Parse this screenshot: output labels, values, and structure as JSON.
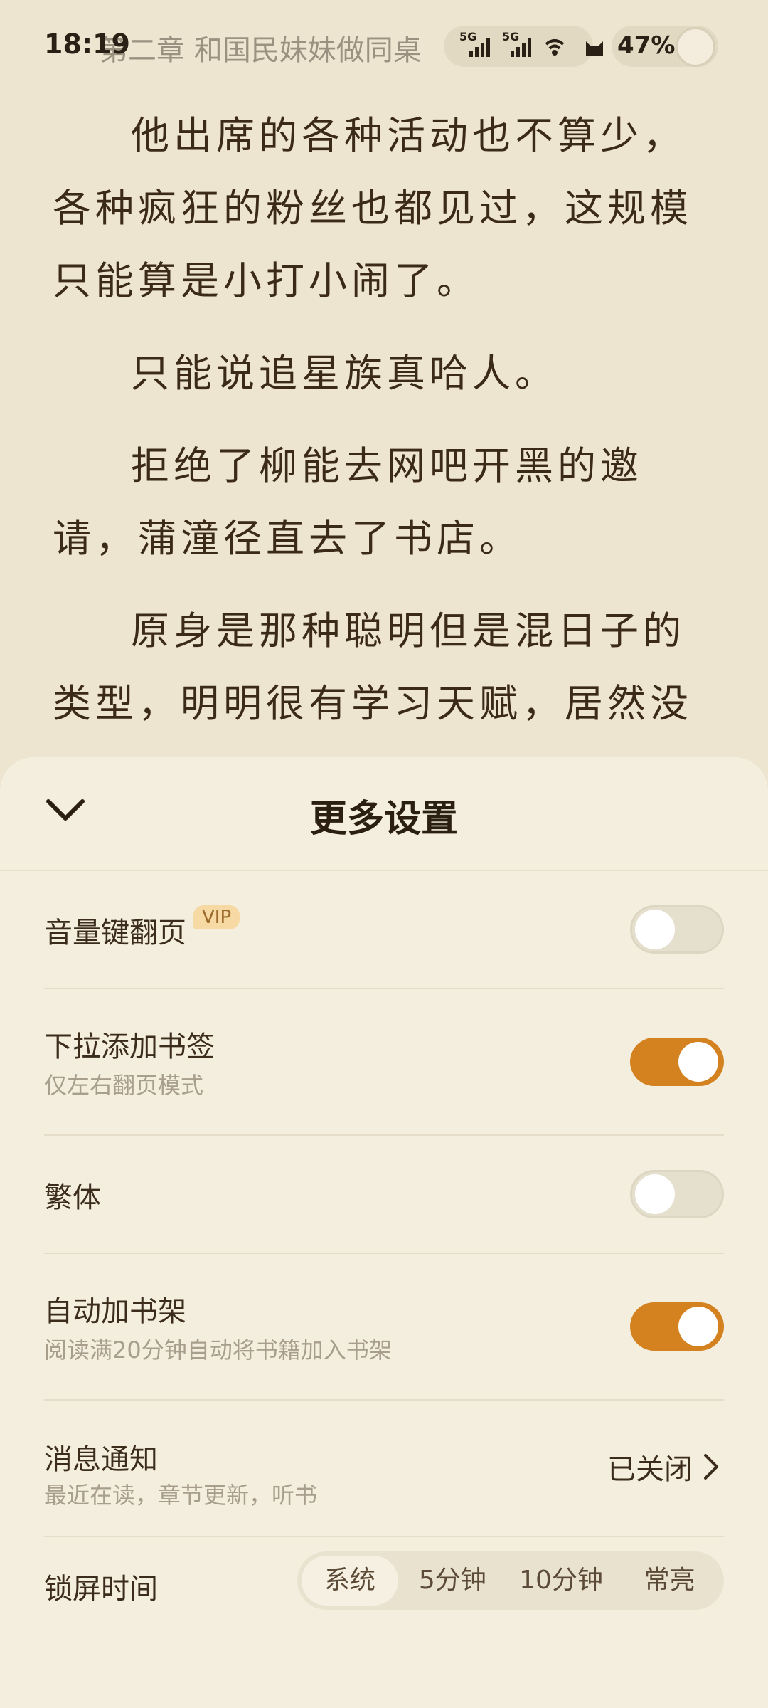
{
  "status_bar": {
    "time": "18:19",
    "chapter_title": "第二章 和国民妹妹做同桌",
    "signal_1": "5G",
    "signal_2": "5G",
    "battery": "47%"
  },
  "reader": {
    "paragraphs": [
      "他出席的各种活动也不算少，各种疯狂的粉丝也都见过，这规模只能算是小打小闹了。",
      "只能说追星族真哈人。",
      "拒绝了柳能去网吧开黑的邀请，蒲潼径直去了书店。",
      "原身是那种聪明但是混日子的类型，明明很有学习天赋，居然没多少学"
    ]
  },
  "sheet": {
    "title": "更多设置",
    "rows": [
      {
        "label": "音量键翻页",
        "badge": "VIP",
        "toggle": false
      },
      {
        "label": "下拉添加书签",
        "sub": "仅左右翻页模式",
        "toggle": true
      },
      {
        "label": "繁体",
        "toggle": false
      },
      {
        "label": "自动加书架",
        "sub": "阅读满20分钟自动将书籍加入书架",
        "toggle": true
      },
      {
        "label": "消息通知",
        "sub": "最近在读，章节更新，听书",
        "value": "已关闭"
      },
      {
        "label": "锁屏时间",
        "options": [
          "系统",
          "5分钟",
          "10分钟",
          "常亮"
        ],
        "selected": "系统"
      }
    ]
  },
  "colors": {
    "accent": "#d4821f",
    "background": "#ede5cf",
    "sheet": "#f4eedf"
  }
}
